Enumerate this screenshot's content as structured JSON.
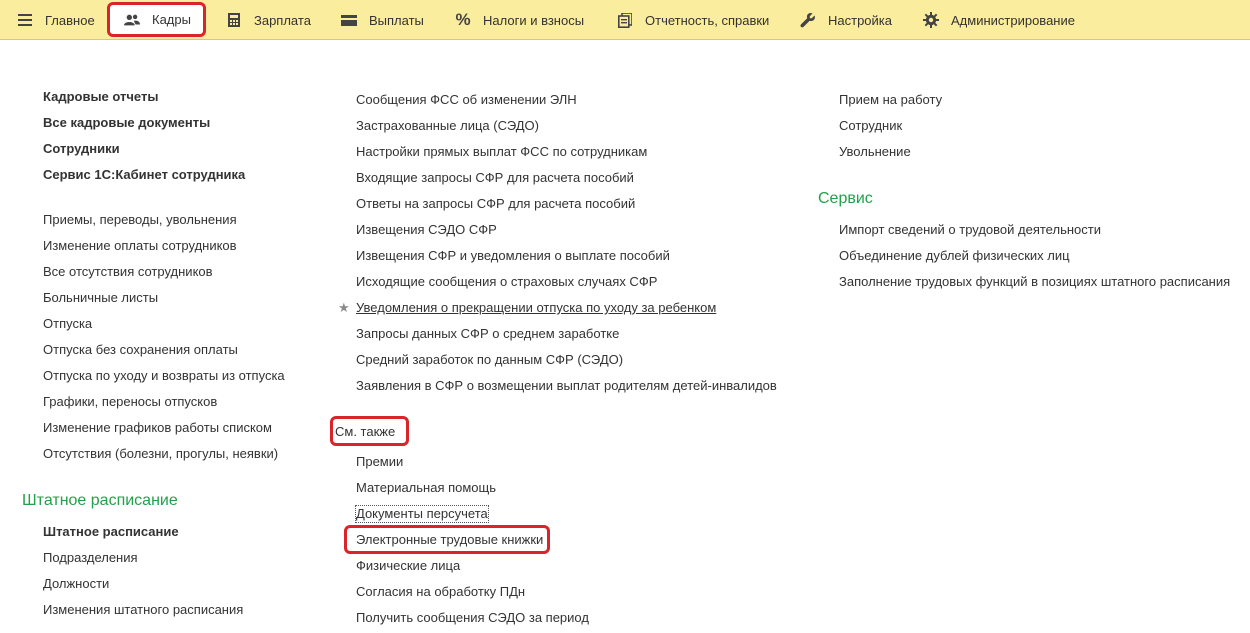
{
  "menu": {
    "main": "Главное",
    "staff": "Кадры",
    "salary": "Зарплата",
    "payments": "Выплаты",
    "taxes": "Налоги и взносы",
    "reports": "Отчетность, справки",
    "settings": "Настройка",
    "admin": "Администрирование"
  },
  "col1": {
    "main_links": [
      "Кадровые отчеты",
      "Все кадровые документы",
      "Сотрудники",
      "Сервис 1С:Кабинет сотрудника"
    ],
    "docs": [
      "Приемы, переводы, увольнения",
      "Изменение оплаты сотрудников",
      "Все отсутствия сотрудников",
      "Больничные листы",
      "Отпуска",
      "Отпуска без сохранения оплаты",
      "Отпуска по уходу и возвраты из отпуска",
      "Графики, переносы отпусков",
      "Изменение графиков работы списком",
      "Отсутствия (болезни, прогулы, неявки)"
    ],
    "staffing_title": "Штатное расписание",
    "staffing": [
      "Штатное расписание",
      "Подразделения",
      "Должности",
      "Изменения штатного расписания"
    ]
  },
  "col2": {
    "links": [
      "Сообщения ФСС об изменении ЭЛН",
      "Застрахованные лица (СЭДО)",
      "Настройки прямых выплат ФСС по сотрудникам",
      "Входящие запросы СФР для расчета пособий",
      "Ответы на запросы СФР для расчета пособий",
      "Извещения СЭДО СФР",
      "Извещения СФР и уведомления о выплате пособий",
      "Исходящие сообщения о страховых случаях СФР",
      "Уведомления о прекращении отпуска по уходу за ребенком",
      "Запросы данных СФР о среднем заработке",
      "Средний заработок по данным СФР (СЭДО)",
      "Заявления в СФР о возмещении выплат родителям детей-инвалидов"
    ],
    "see_also_title": "См. также",
    "see_also": [
      "Премии",
      "Материальная помощь",
      "Документы персучета",
      "Электронные трудовые книжки",
      "Физические лица",
      "Согласия на обработку ПДн",
      "Получить сообщения СЭДО за период"
    ]
  },
  "col3": {
    "links": [
      "Прием на работу",
      "Сотрудник",
      "Увольнение"
    ],
    "service_title": "Сервис",
    "service": [
      "Импорт сведений о трудовой деятельности",
      "Объединение дублей физических лиц",
      "Заполнение трудовых функций в позициях штатного расписания"
    ]
  },
  "colors": {
    "menu_bg": "#fbed9e",
    "section_title": "#22a14a",
    "highlight": "#d9252a"
  },
  "icons": [
    "menu-icon",
    "people-icon",
    "calculator-icon",
    "wallet-icon",
    "percent-icon",
    "documents-icon",
    "wrench-icon",
    "gear-icon",
    "star-icon"
  ]
}
